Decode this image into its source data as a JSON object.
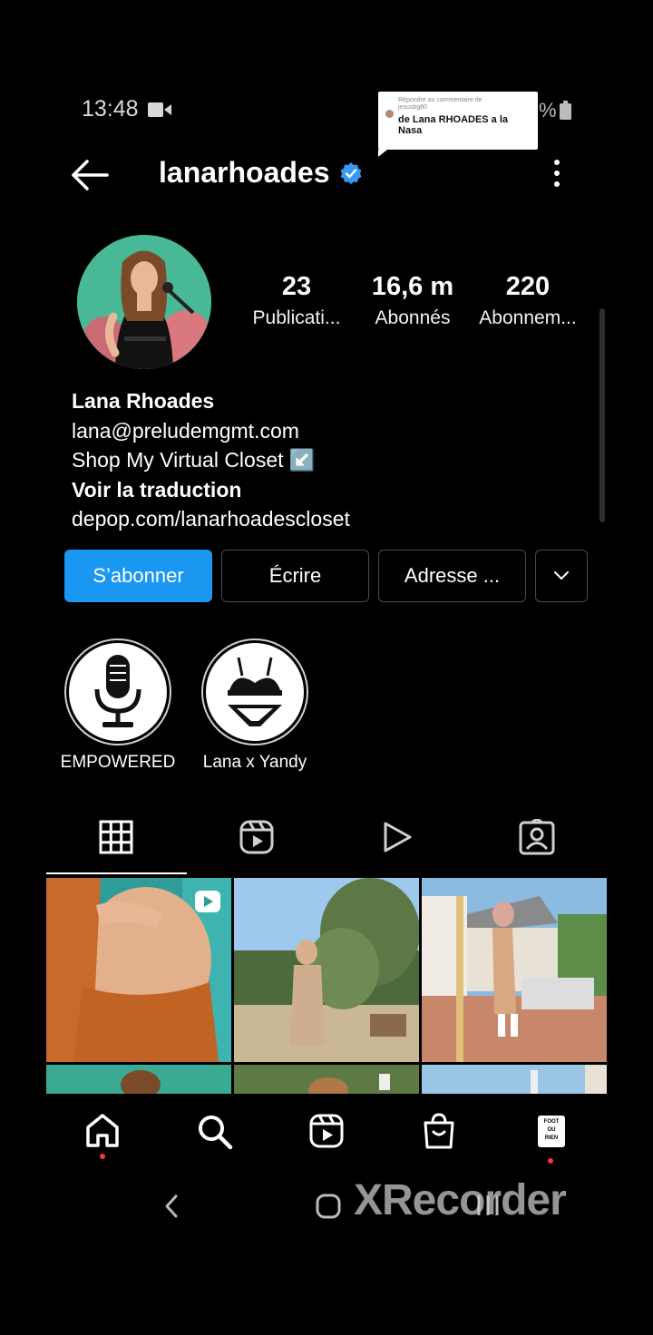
{
  "status_bar": {
    "time": "13:48",
    "battery_pct": "%"
  },
  "notification": {
    "line1": "Répondre au commentaire de",
    "line2": "jesusbg80",
    "message": "de Lana RHOADES a la Nasa"
  },
  "header": {
    "username": "lanarhoades"
  },
  "stats": [
    {
      "value": "23",
      "label": "Publicati..."
    },
    {
      "value": "16,6 m",
      "label": "Abonnés"
    },
    {
      "value": "220",
      "label": "Abonnem..."
    }
  ],
  "bio": {
    "name": "Lana Rhoades",
    "email": "lana@preludemgmt.com",
    "line": "Shop My Virtual Closet ↙️",
    "translate": "Voir la traduction",
    "link": "depop.com/lanarhoadescloset"
  },
  "buttons": {
    "follow": "S’abonner",
    "message": "Écrire",
    "address": "Adresse ..."
  },
  "highlights": [
    {
      "label": "EMPOWERED",
      "icon": "microphone-icon"
    },
    {
      "label": "Lana x Yandy",
      "icon": "lingerie-icon"
    }
  ],
  "bottom_nav": {
    "profile_text": [
      "FOOT",
      "OU",
      "RIEN"
    ]
  },
  "watermark": "XRecorder",
  "colors": {
    "accent": "#1a97f0",
    "verified": "#3897f0",
    "notification_dot": "#ff3040"
  }
}
